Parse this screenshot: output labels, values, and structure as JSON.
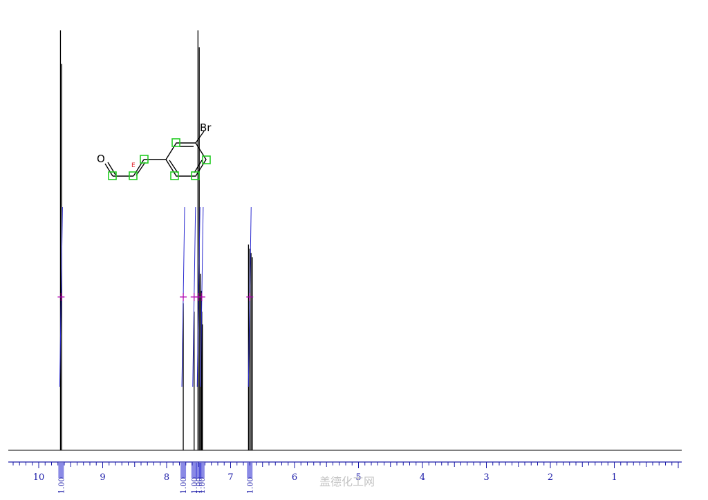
{
  "chart_data": {
    "type": "line",
    "title": "",
    "xlabel": "",
    "ylabel": "",
    "x_axis": {
      "reversed": true,
      "xlim": [
        10.5,
        -0.1
      ],
      "ticks": [
        "10",
        "9",
        "8",
        "7",
        "6",
        "5",
        "4",
        "3",
        "2",
        "1"
      ]
    },
    "grid": false,
    "peaks": [
      {
        "ppm": 9.66,
        "intensity": 1.0
      },
      {
        "ppm": 9.64,
        "intensity": 0.92
      },
      {
        "ppm": 7.74,
        "intensity": 0.35
      },
      {
        "ppm": 7.57,
        "intensity": 0.33
      },
      {
        "ppm": 7.51,
        "intensity": 1.0
      },
      {
        "ppm": 7.49,
        "intensity": 0.96
      },
      {
        "ppm": 7.47,
        "intensity": 0.42
      },
      {
        "ppm": 7.46,
        "intensity": 0.38
      },
      {
        "ppm": 7.45,
        "intensity": 0.33
      },
      {
        "ppm": 7.44,
        "intensity": 0.3
      },
      {
        "ppm": 6.72,
        "intensity": 0.49
      },
      {
        "ppm": 6.7,
        "intensity": 0.48
      },
      {
        "ppm": 6.68,
        "intensity": 0.47
      },
      {
        "ppm": 6.66,
        "intensity": 0.46
      }
    ],
    "integrals": [
      {
        "ppm": 9.65,
        "label": "1.00"
      },
      {
        "ppm": 7.74,
        "label": "1.00"
      },
      {
        "ppm": 7.57,
        "label": "1.00"
      },
      {
        "ppm": 7.5,
        "label": "1.00"
      },
      {
        "ppm": 7.45,
        "label": "1.00"
      },
      {
        "ppm": 6.7,
        "label": "1.00"
      }
    ]
  },
  "structure": {
    "oxygen_label": "O",
    "bromine_label": "Br",
    "stereo_label": "E"
  },
  "watermark": "盖德化工网",
  "colors": {
    "spectrum": "#000000",
    "axis": "#1a1aa8",
    "integral": "#2a2ad0",
    "peak_marker": "#b000b0",
    "highlight": "#22cc22"
  }
}
